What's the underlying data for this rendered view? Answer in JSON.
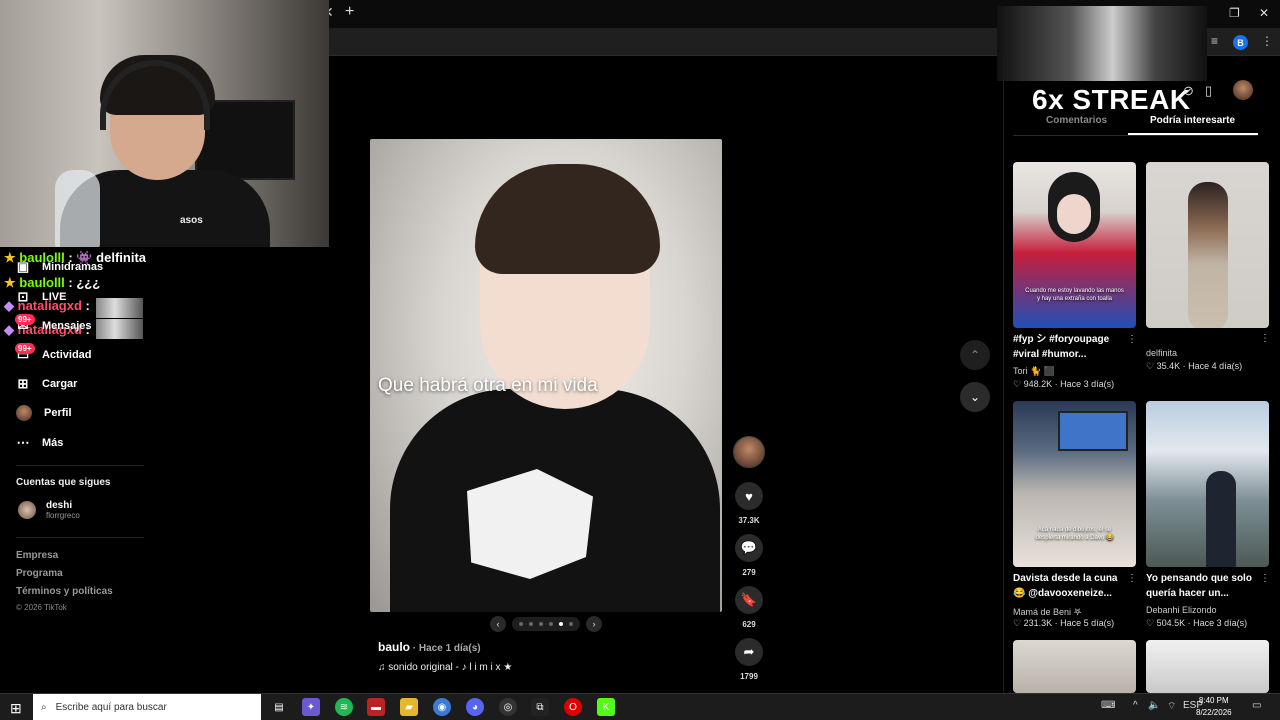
{
  "browser": {
    "close_tab": "✕",
    "new_tab": "+",
    "profile_initial": "B"
  },
  "overlay": {
    "streak": "6x STREAK"
  },
  "chat": [
    {
      "name": "baulolll",
      "sep": " :",
      "msg": "",
      "extra": "delfinita"
    },
    {
      "name": "baulolll",
      "sep": " :",
      "msg": " ¿¿¿"
    },
    {
      "name": "nataliagxd",
      "sep": " :",
      "msg": ""
    },
    {
      "name": "nataliagxd",
      "sep": " :",
      "msg": ""
    }
  ],
  "sidebar": {
    "items": [
      {
        "label": "Minidramas",
        "icon": "film-icon"
      },
      {
        "label": "LIVE",
        "icon": "tv-icon"
      },
      {
        "label": "Mensajes",
        "icon": "message-icon"
      },
      {
        "label": "Actividad",
        "icon": "bell-icon",
        "badge": "99+"
      },
      {
        "label": "Cargar",
        "icon": "upload-icon"
      },
      {
        "label": "Perfil",
        "icon": "avatar"
      },
      {
        "label": "Más",
        "icon": "more-icon"
      }
    ],
    "badge_messages": "99+",
    "following_title": "Cuentas que sigues",
    "following": [
      {
        "name": "deshi",
        "user": "florrgreco"
      }
    ],
    "footer": [
      "Empresa",
      "Programa",
      "Términos y políticas"
    ],
    "copyright": "© 2026 TikTok"
  },
  "video": {
    "caption": "Que habrá otra en mi vida",
    "author": "baulo",
    "time": " · Hace 1 día(s)",
    "sound": "♫  sonido original - ♪ l i m i x ★",
    "carousel_dots": 6,
    "carousel_active": 4,
    "shirt_logo": "asos"
  },
  "actions": {
    "likes": "37.3K",
    "comments": "279",
    "saves": "629",
    "shares": "1799"
  },
  "right_panel": {
    "tabs": [
      "Comentarios",
      "Podría interesarte"
    ],
    "active_tab": 1,
    "cards": [
      {
        "title": "#fyp シ #foryoupage #viral #humor...",
        "author": "Tori 🐈 ⬛",
        "stats": "♡ 948.2K · Hace 3 día(s)",
        "overlay": "Cuando me estoy lavando las manos y hay una extraña con toalla"
      },
      {
        "title": "",
        "author": "delfinita",
        "stats": "♡ 35.4K · Hace 4 día(s)",
        "overlay": ""
      },
      {
        "title": "Davista desde la cuna 😂 @davooxeneize...",
        "author": "Mamá de Beni 𖤐",
        "stats": "♡ 231.3K · Hace 5 día(s)",
        "overlay": "Acá nada de dibujitos, él se despierta mirando a Davo 😂"
      },
      {
        "title": "Yo pensando que solo quería hacer un...",
        "author": "Debanhi Elizondo",
        "stats": "♡ 504.5K · Hace 3 día(s)",
        "overlay": ""
      }
    ]
  },
  "taskbar": {
    "search_placeholder": "Escribe aquí para buscar",
    "language": "ESP",
    "time": "8:40 PM",
    "date": "8/22/2026"
  },
  "colors": {
    "accent": "#fe2c55",
    "chat_name": "#7CFC00"
  }
}
